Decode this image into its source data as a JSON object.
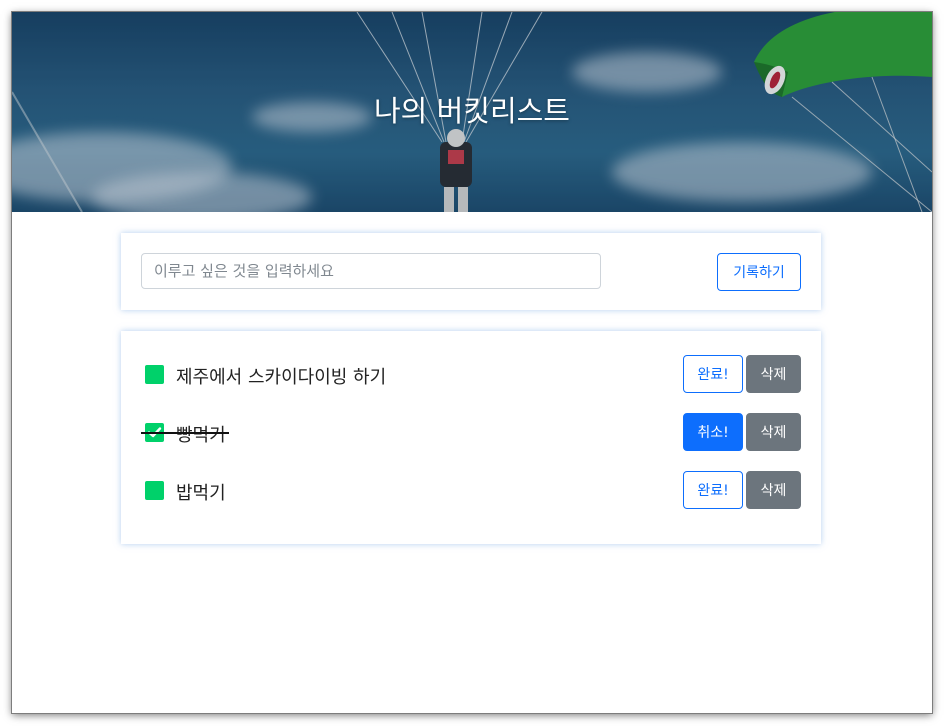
{
  "header": {
    "title": "나의 버킷리스트"
  },
  "input_card": {
    "placeholder": "이루고 싶은 것을 입력하세요",
    "value": "",
    "submit_label": "기록하기"
  },
  "bucket_list": [
    {
      "text": "제주에서 스카이다이빙 하기",
      "done": false,
      "action_label": "완료!",
      "delete_label": "삭제"
    },
    {
      "text": "빵먹기",
      "done": true,
      "action_label": "취소!",
      "delete_label": "삭제"
    },
    {
      "text": "밥먹기",
      "done": false,
      "action_label": "완료!",
      "delete_label": "삭제"
    }
  ],
  "colors": {
    "check_green": "#00d16a",
    "primary_blue": "#0d6efd",
    "secondary_gray": "#6c757d"
  },
  "icons": {
    "done_mark": "checkmark-icon"
  }
}
